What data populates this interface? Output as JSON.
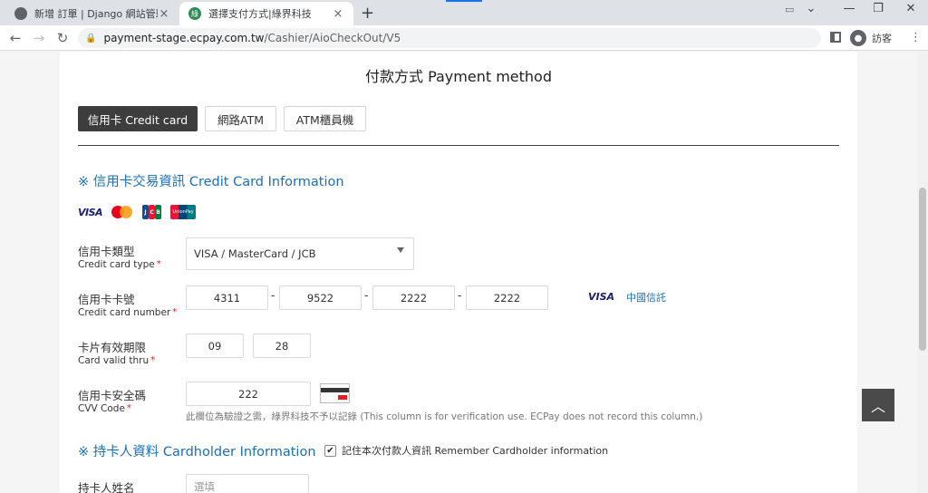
{
  "browser": {
    "tabs": [
      {
        "title": "新增 訂單 | Django 網站管理",
        "active": false
      },
      {
        "title": "選擇支付方式|綠界科技",
        "active": true
      }
    ],
    "new_tab": "+",
    "tab_close": "×",
    "window_controls": {
      "tab_search": "⌄",
      "minimize": "—",
      "maximize": "❐",
      "close": "✕"
    },
    "address": {
      "host": "payment-stage.ecpay.com.tw",
      "path": "/Cashier/AioCheckOut/V5"
    },
    "profile_label": "訪客"
  },
  "page": {
    "title": "付款方式 Payment method",
    "method_tabs": [
      {
        "label": "信用卡 Credit card",
        "active": true
      },
      {
        "label": "網路ATM",
        "active": false
      },
      {
        "label": "ATM櫃員機",
        "active": false
      }
    ],
    "credit_section_title": "※ 信用卡交易資訊 Credit Card Information",
    "brands": {
      "visa": "VISA",
      "jcb": [
        "J",
        "C",
        "B"
      ],
      "unionpay": "UnionPay"
    },
    "card_type": {
      "label_zh": "信用卡類型",
      "label_en": "Credit card type",
      "value": "VISA / MasterCard / JCB"
    },
    "card_number": {
      "label_zh": "信用卡卡號",
      "label_en": "Credit card number",
      "parts": [
        "4311",
        "9522",
        "2222",
        "2222"
      ],
      "separator": "-",
      "brand": "VISA",
      "bank": "中國信託"
    },
    "valid_thru": {
      "label_zh": "卡片有效期限",
      "label_en": "Card valid thru",
      "month": "09",
      "year": "28"
    },
    "cvv": {
      "label_zh": "信用卡安全碼",
      "label_en": "CVV Code",
      "value": "222",
      "note": "此欄位為驗證之需，綠界科技不予以記錄 (This column is for verification use. ECPay does not record this column.)"
    },
    "required_mark": "*",
    "cardholder_section_title": "※ 持卡人資料 Cardholder Information",
    "remember": {
      "label": "記住本次付款人資訊 Remember Cardholder information",
      "checked": true
    },
    "holder_name": {
      "label_zh": "持卡人姓名",
      "placeholder": "選填"
    },
    "back_to_top": "︿"
  },
  "colors": {
    "accent": "#1a6fb5",
    "active_tab": "#3d3d3d",
    "required": "#e02020"
  }
}
